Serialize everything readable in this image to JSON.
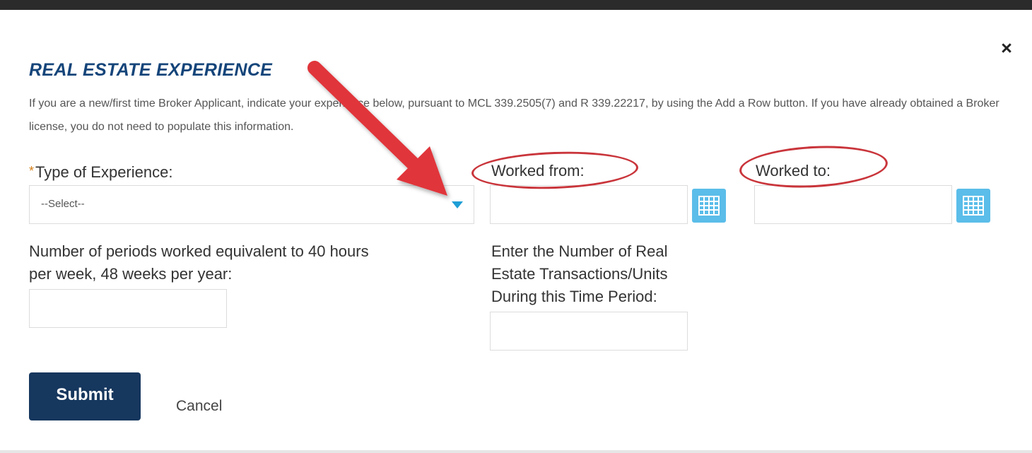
{
  "modal": {
    "close_glyph": "×",
    "title": "REAL ESTATE EXPERIENCE",
    "intro_text": "If you are a new/first time Broker Applicant, indicate your experience below, pursuant to MCL 339.2505(7) and R 339.22217, by using the Add a Row button. If you have already obtained a Broker license, you do not need to populate this information."
  },
  "form": {
    "type_of_experience": {
      "required_marker": "*",
      "label": "Type of Experience:",
      "selected_value": "--Select--"
    },
    "worked_from": {
      "label": "Worked from:",
      "value": ""
    },
    "worked_to": {
      "label": "Worked to:",
      "value": ""
    },
    "periods": {
      "label_line1": "Number of periods worked equivalent to 40 hours",
      "label_line2": "per week, 48 weeks per year:",
      "value": ""
    },
    "transactions": {
      "label_line1": "Enter the Number of Real",
      "label_line2": "Estate Transactions/Units",
      "label_line3": "During this Time Period:",
      "value": ""
    },
    "submit_label": "Submit",
    "cancel_label": "Cancel"
  },
  "icons": {
    "calendar": "calendar-icon",
    "close": "close-icon",
    "dropdown": "chevron-down-icon"
  },
  "colors": {
    "title": "#15457a",
    "submit_bg": "#16375e",
    "calendar_bg": "#5bbde9",
    "annotation": "#e0343a",
    "required": "#d4801a"
  }
}
